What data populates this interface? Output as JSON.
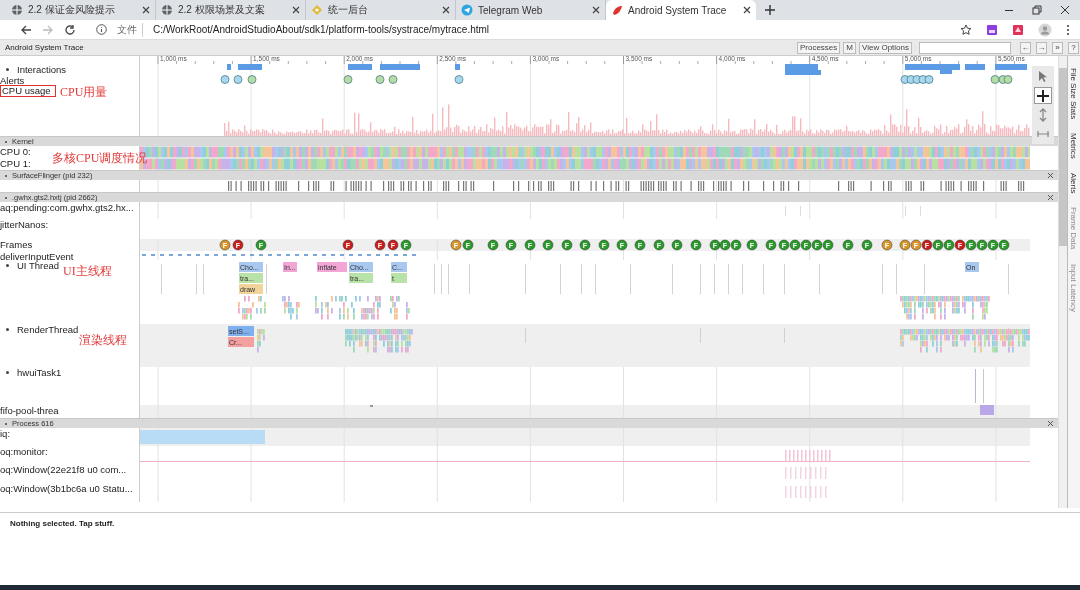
{
  "browser": {
    "tabs": [
      {
        "title": "2.2 保证金风险提示",
        "kind": "globe",
        "selected": false
      },
      {
        "title": "2.2 权限场景及文案",
        "kind": "globe",
        "selected": false
      },
      {
        "title": "统一后台",
        "kind": "diamond",
        "selected": false
      },
      {
        "title": "Telegram Web",
        "kind": "telegram",
        "selected": false
      },
      {
        "title": "Android System Trace",
        "kind": "trace",
        "selected": true
      }
    ],
    "address": {
      "scheme": "文件",
      "url": "C:/WorkRoot/AndroidStudioAbout/sdk1/platform-tools/systrace/mytrace.html"
    }
  },
  "app": {
    "title": "Android System Trace",
    "buttons": [
      "Processes",
      "M",
      "View Options"
    ],
    "nav_buttons": [
      "←",
      "→",
      "»",
      "?"
    ]
  },
  "ruler": {
    "ticks": [
      "1,000 ms",
      "1,500 ms",
      "2,000 ms",
      "2,500 ms",
      "3,000 ms",
      "3,500 ms",
      "4,000 ms",
      "4,500 ms",
      "5,000 ms",
      "5,500 ms"
    ]
  },
  "tools": [
    {
      "kind": "select",
      "selected": false
    },
    {
      "kind": "pan",
      "selected": true
    },
    {
      "kind": "zoom",
      "selected": false
    },
    {
      "kind": "timing",
      "selected": false
    }
  ],
  "tracks": [
    {
      "kind": "interactions",
      "label": "Interactions",
      "bullet": true
    },
    {
      "kind": "alerts",
      "label": "Alerts",
      "alerts": [
        {
          "color": "#a8d8ef"
        },
        {
          "color": "#a8d8ef"
        },
        {
          "color": "#b5dca2"
        },
        {
          "color": "#b5dca2"
        },
        {
          "color": "#b5dca2"
        },
        {
          "color": "#b5dca2"
        },
        {
          "color": "#a8d8ef"
        },
        {
          "color": "#a8d8ef"
        },
        {
          "color": "#a8d8ef"
        },
        {
          "color": "#a8d8ef"
        },
        {
          "color": "#a8d8ef"
        },
        {
          "color": "#a8d8ef"
        },
        {
          "color": "#b5dca2"
        },
        {
          "color": "#b5dca2"
        },
        {
          "color": "#b5dca2"
        }
      ]
    },
    {
      "kind": "cpu_usage",
      "label": "CPU usage",
      "highlighted": true,
      "annotation": "CPU用量"
    },
    {
      "kind": "header",
      "label": "Kernel"
    },
    {
      "kind": "cpu_slices",
      "label": "CPU 0:",
      "annotation": "多核CPU调度情况"
    },
    {
      "kind": "cpu_slices",
      "label": "CPU 1:"
    },
    {
      "kind": "header",
      "label": "SurfaceFlinger (pid 232)"
    },
    {
      "kind": "ticks"
    },
    {
      "kind": "header",
      "label": ".gwhx.gts2.hxtj (pid 2662)"
    },
    {
      "kind": "pending",
      "label": "aq:pending:com.gwhx.gts2.hx..."
    },
    {
      "kind": "empty",
      "label": "jitterNanos:"
    },
    {
      "kind": "frames",
      "label": "Frames",
      "frames": [
        {
          "label": "F",
          "color": "#d8962a"
        },
        {
          "label": "F",
          "color": "#c81e1e"
        },
        {
          "label": "F",
          "color": "#2a9a2a"
        },
        {
          "label": "F",
          "color": "#c81e1e"
        },
        {
          "label": "F",
          "color": "#c81e1e"
        },
        {
          "label": "F",
          "color": "#c81e1e"
        },
        {
          "label": "F",
          "color": "#2a9a2a"
        },
        {
          "label": "F",
          "color": "#d8962a"
        },
        {
          "label": "F",
          "color": "#2a9a2a"
        },
        {
          "label": "F",
          "color": "#2a9a2a"
        },
        {
          "label": "F",
          "color": "#2a9a2a"
        },
        {
          "label": "F",
          "color": "#2a9a2a"
        },
        {
          "label": "F",
          "color": "#2a9a2a"
        },
        {
          "label": "F",
          "color": "#2a9a2a"
        },
        {
          "label": "F",
          "color": "#2a9a2a"
        },
        {
          "label": "F",
          "color": "#2a9a2a"
        },
        {
          "label": "F",
          "color": "#2a9a2a"
        },
        {
          "label": "F",
          "color": "#2a9a2a"
        },
        {
          "label": "F",
          "color": "#2a9a2a"
        },
        {
          "label": "F",
          "color": "#2a9a2a"
        },
        {
          "label": "F",
          "color": "#2a9a2a"
        },
        {
          "label": "F",
          "color": "#2a9a2a"
        },
        {
          "label": "F",
          "color": "#2a9a2a"
        },
        {
          "label": "F",
          "color": "#2a9a2a"
        },
        {
          "label": "F",
          "color": "#2a9a2a"
        },
        {
          "label": "F",
          "color": "#2a9a2a"
        },
        {
          "label": "F",
          "color": "#2a9a2a"
        },
        {
          "label": "F",
          "color": "#2a9a2a"
        },
        {
          "label": "F",
          "color": "#2a9a2a"
        },
        {
          "label": "F",
          "color": "#2a9a2a"
        },
        {
          "label": "F",
          "color": "#2a9a2a"
        },
        {
          "label": "F",
          "color": "#2a9a2a"
        },
        {
          "label": "F",
          "color": "#2a9a2a"
        },
        {
          "label": "F",
          "color": "#d8962a"
        },
        {
          "label": "F",
          "color": "#d8962a"
        },
        {
          "label": "F",
          "color": "#d8962a"
        },
        {
          "label": "F",
          "color": "#c81e1e"
        },
        {
          "label": "F",
          "color": "#2a9a2a"
        },
        {
          "label": "F",
          "color": "#2a9a2a"
        },
        {
          "label": "F",
          "color": "#c81e1e"
        },
        {
          "label": "F",
          "color": "#2a9a2a"
        },
        {
          "label": "F",
          "color": "#2a9a2a"
        },
        {
          "label": "F",
          "color": "#2a9a2a"
        },
        {
          "label": "F",
          "color": "#2a9a2a"
        }
      ]
    },
    {
      "kind": "input",
      "label": "deliverInputEvent"
    },
    {
      "kind": "main_thread",
      "label": "UI Thread",
      "bullet": true,
      "annotation": "UI主线程",
      "slices": [
        {
          "label": "Cho...",
          "color": "#a9c8f0"
        },
        {
          "label": "tra...",
          "color": "#b9e2a8"
        },
        {
          "label": "draw",
          "color": "#f1d49b"
        },
        {
          "label": "In...",
          "color": "#f3a6d6"
        },
        {
          "label": "inflate",
          "color": "#f3a6d6"
        },
        {
          "label": "Cho...",
          "color": "#a9c8f0"
        },
        {
          "label": "tra...",
          "color": "#b9e2a8"
        },
        {
          "label": "C...",
          "color": "#a9c8f0"
        },
        {
          "label": "t",
          "color": "#b9e2a8"
        },
        {
          "label": "On",
          "color": "#a9c8f0"
        }
      ]
    },
    {
      "kind": "render_thread",
      "label": "RenderThread",
      "bullet": true,
      "annotation": "渲染线程",
      "slices": [
        {
          "label": "setS...",
          "color": "#7fb0ee"
        },
        {
          "label": "Cr...",
          "color": "#f3a0a0"
        }
      ]
    },
    {
      "kind": "sparse",
      "label": "hwuiTask1",
      "bullet": true
    },
    {
      "kind": "fifo",
      "label": "fifo-pool-threa"
    },
    {
      "kind": "header",
      "label": "Process 616"
    },
    {
      "kind": "iq",
      "label": "iq:"
    },
    {
      "kind": "monitor",
      "label": "oq:monitor:"
    },
    {
      "kind": "window",
      "label": "oq:Window(22e21f8 u0 com..."
    },
    {
      "kind": "window",
      "label": "oq:Window(3b1bc6a u0 Statu..."
    }
  ],
  "side_tabs": [
    {
      "label": "File Size Stats",
      "disabled": false
    },
    {
      "label": "Metrics",
      "disabled": false
    },
    {
      "label": "Alerts",
      "disabled": false
    },
    {
      "label": "Frame Data",
      "disabled": true
    },
    {
      "label": "Input Latency",
      "disabled": true
    }
  ],
  "status": "Nothing selected. Tap stuff."
}
